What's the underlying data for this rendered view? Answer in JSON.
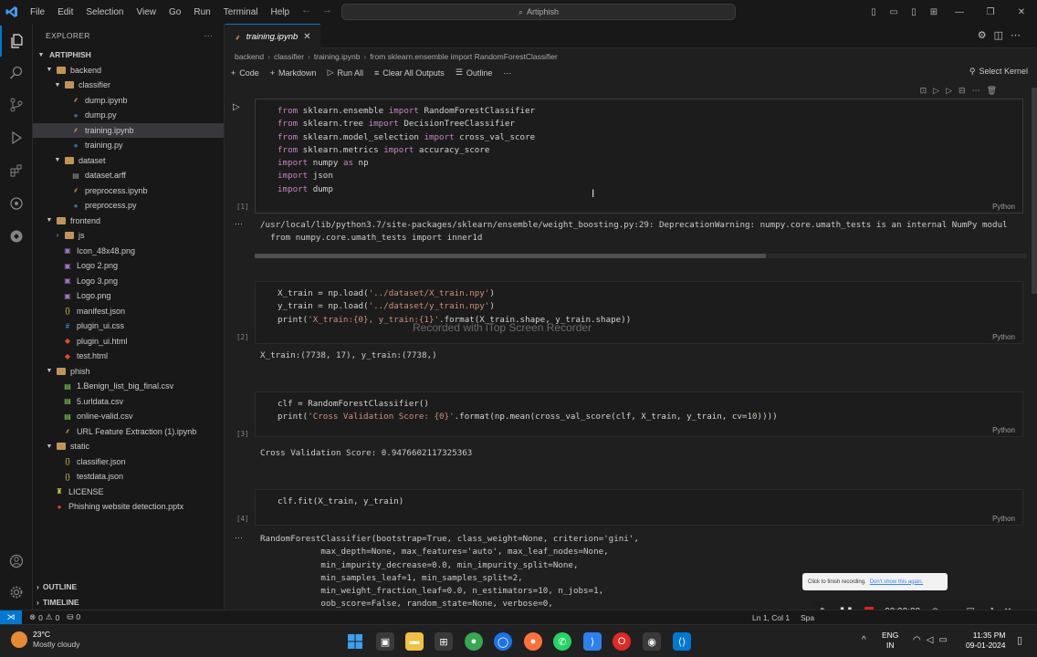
{
  "titlebar": {
    "logo": "⟨⟩",
    "menu": [
      "File",
      "Edit",
      "Selection",
      "View",
      "Go",
      "Run",
      "Terminal",
      "Help"
    ],
    "search_text": "Artiphish",
    "search_icon": "search-icon"
  },
  "sidebar": {
    "title": "EXPLORER",
    "more": "···",
    "root": "ARTIPHISH",
    "tree": [
      {
        "label": "backend",
        "type": "folder",
        "depth": 1,
        "open": true
      },
      {
        "label": "classifier",
        "type": "folder",
        "depth": 2,
        "open": true
      },
      {
        "label": "dump.ipynb",
        "type": "notebook",
        "depth": 3
      },
      {
        "label": "dump.py",
        "type": "python",
        "depth": 3
      },
      {
        "label": "training.ipynb",
        "type": "notebook",
        "depth": 3,
        "selected": true
      },
      {
        "label": "training.py",
        "type": "python",
        "depth": 3
      },
      {
        "label": "dataset",
        "type": "folder",
        "depth": 2,
        "open": true
      },
      {
        "label": "dataset.arff",
        "type": "file",
        "depth": 3
      },
      {
        "label": "preprocess.ipynb",
        "type": "notebook",
        "depth": 3
      },
      {
        "label": "preprocess.py",
        "type": "python",
        "depth": 3
      },
      {
        "label": "frontend",
        "type": "folder",
        "depth": 1,
        "open": true
      },
      {
        "label": "js",
        "type": "folder",
        "depth": 2,
        "open": false
      },
      {
        "label": "Icon_48x48.png",
        "type": "image",
        "depth": 2
      },
      {
        "label": "Logo 2.png",
        "type": "image",
        "depth": 2
      },
      {
        "label": "Logo 3.png",
        "type": "image",
        "depth": 2
      },
      {
        "label": "Logo.png",
        "type": "image",
        "depth": 2
      },
      {
        "label": "manifest.json",
        "type": "json",
        "depth": 2
      },
      {
        "label": "plugin_ui.css",
        "type": "css",
        "depth": 2
      },
      {
        "label": "plugin_ui.html",
        "type": "html",
        "depth": 2
      },
      {
        "label": "test.html",
        "type": "html",
        "depth": 2
      },
      {
        "label": "phish",
        "type": "folder",
        "depth": 1,
        "open": true
      },
      {
        "label": "1.Benign_list_big_final.csv",
        "type": "csv",
        "depth": 2
      },
      {
        "label": "5.urldata.csv",
        "type": "csv",
        "depth": 2
      },
      {
        "label": "online-valid.csv",
        "type": "csv",
        "depth": 2
      },
      {
        "label": "URL Feature Extraction (1).ipynb",
        "type": "notebook",
        "depth": 2
      },
      {
        "label": "static",
        "type": "folder",
        "depth": 1,
        "open": true
      },
      {
        "label": "classifier.json",
        "type": "json",
        "depth": 2
      },
      {
        "label": "testdata.json",
        "type": "json",
        "depth": 2
      },
      {
        "label": "LICENSE",
        "type": "license",
        "depth": 1
      },
      {
        "label": "Phishing website detection.pptx",
        "type": "pptx",
        "depth": 1
      }
    ],
    "outline": "OUTLINE",
    "timeline": "TIMELINE"
  },
  "editor": {
    "tab_label": "training.ipynb",
    "tab_close": "✕",
    "breadcrumb": [
      "backend",
      "classifier",
      "training.ipynb",
      "from sklearn.ensemble import RandomForestClassifier"
    ],
    "toolbar": {
      "code": "Code",
      "markdown": "Markdown",
      "run_all": "Run All",
      "clear_all": "Clear All Outputs",
      "outline": "Outline",
      "more": "···",
      "kernel": "Select Kernel"
    },
    "lang": "Python",
    "cells": [
      {
        "exec": "[1]",
        "lines": [
          "from sklearn.ensemble import RandomForestClassifier",
          "from sklearn.tree import DecisionTreeClassifier",
          "from sklearn.model_selection import cross_val_score",
          "from sklearn.metrics import accuracy_score",
          "import numpy as np",
          "import json",
          "import dump"
        ],
        "output": [
          "/usr/local/lib/python3.7/site-packages/sklearn/ensemble/weight_boosting.py:29: DeprecationWarning: numpy.core.umath_tests is an internal NumPy modul",
          "  from numpy.core.umath_tests import inner1d"
        ]
      },
      {
        "exec": "[2]",
        "lines": [
          "X_train = np.load('../dataset/X_train.npy')",
          "y_train = np.load('../dataset/y_train.npy')",
          "print('X_train:{0}, y_train:{1}'.format(X_train.shape, y_train.shape))"
        ],
        "output": [
          "X_train:(7738, 17), y_train:(7738,)"
        ]
      },
      {
        "exec": "[3]",
        "lines": [
          "clf = RandomForestClassifier()",
          "print('Cross Validation Score: {0}'.format(np.mean(cross_val_score(clf, X_train, y_train, cv=10))))"
        ],
        "output": [
          "Cross Validation Score: 0.9476602117325363"
        ]
      },
      {
        "exec": "[4]",
        "lines": [
          "clf.fit(X_train, y_train)"
        ],
        "output": [
          "RandomForestClassifier(bootstrap=True, class_weight=None, criterion='gini',",
          "            max_depth=None, max_features='auto', max_leaf_nodes=None,",
          "            min_impurity_decrease=0.0, min_impurity_split=None,",
          "            min_samples_leaf=1, min_samples_split=2,",
          "            min_weight_fraction_leaf=0.0, n_estimators=10, n_jobs=1,",
          "            oob_score=False, random_state=None, verbose=0,"
        ]
      }
    ],
    "watermark": "Recorded with iTop Screen Recorder"
  },
  "statusbar": {
    "errors": "0",
    "warnings": "0",
    "ports": "0",
    "position": "Ln 1, Col 1",
    "spaces": "Spa"
  },
  "recorder": {
    "tooltip": "Click to finish recording.",
    "tooltip_link": "Don't show this again.",
    "time": "00:00:00"
  },
  "taskbar": {
    "weather_temp": "23°C",
    "weather_desc": "Mostly cloudy",
    "lang_top": "ENG",
    "lang_bottom": "IN",
    "time": "11:35 PM",
    "date": "09-01-2024"
  },
  "colors": {
    "accent": "#0078d4",
    "folder": "#c09553",
    "python": "#3572a5",
    "notebook": "#e8a85f",
    "json": "#cbcb41",
    "html": "#e44d26",
    "csv": "#89e051",
    "image": "#a074c4"
  }
}
